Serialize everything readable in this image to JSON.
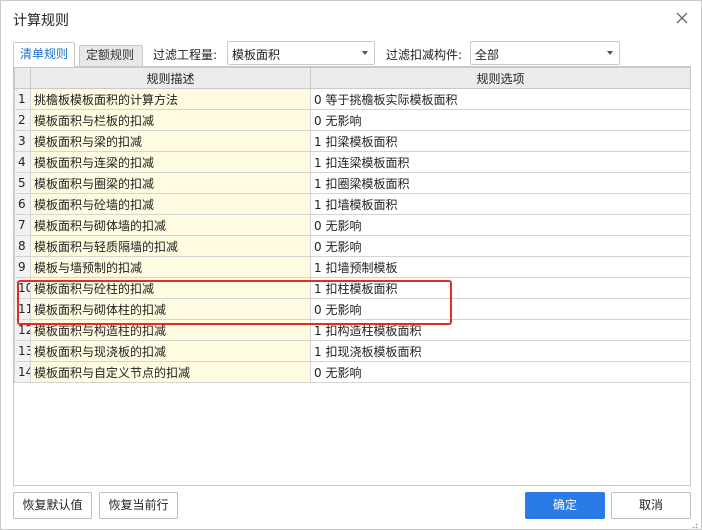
{
  "dialog": {
    "title": "计算规则"
  },
  "tabs": [
    {
      "label": "清单规则",
      "active": true
    },
    {
      "label": "定额规则",
      "active": false
    }
  ],
  "filters": {
    "engineering_label": "过滤工程量:",
    "engineering_value": "模板面积",
    "component_label": "过滤扣减构件:",
    "component_value": "全部"
  },
  "table": {
    "headers": [
      "",
      "规则描述",
      "规则选项"
    ],
    "rows": [
      {
        "num": "1",
        "desc": "挑檐板模板面积的计算方法",
        "opt": "0 等于挑檐板实际模板面积"
      },
      {
        "num": "2",
        "desc": "模板面积与栏板的扣减",
        "opt": "0  无影响"
      },
      {
        "num": "3",
        "desc": "模板面积与梁的扣减",
        "opt": "1 扣梁模板面积"
      },
      {
        "num": "4",
        "desc": "模板面积与连梁的扣减",
        "opt": "1 扣连梁模板面积"
      },
      {
        "num": "5",
        "desc": "模板面积与圈梁的扣减",
        "opt": "1 扣圈梁模板面积"
      },
      {
        "num": "6",
        "desc": "模板面积与砼墙的扣减",
        "opt": "1 扣墙模板面积"
      },
      {
        "num": "7",
        "desc": "模板面积与砌体墙的扣减",
        "opt": "0  无影响"
      },
      {
        "num": "8",
        "desc": "模板面积与轻质隔墙的扣减",
        "opt": "0  无影响"
      },
      {
        "num": "9",
        "desc": "模板与墙预制的扣减",
        "opt": "1  扣墙预制模板"
      },
      {
        "num": "10",
        "desc": "模板面积与砼柱的扣减",
        "opt": "1 扣柱模板面积"
      },
      {
        "num": "11",
        "desc": "模板面积与砌体柱的扣减",
        "opt": "0  无影响"
      },
      {
        "num": "12",
        "desc": "模板面积与构造柱的扣减",
        "opt": "1 扣构造柱模板面积"
      },
      {
        "num": "13",
        "desc": "模板面积与现浇板的扣减",
        "opt": "1 扣现浇板模板面积"
      },
      {
        "num": "14",
        "desc": "模板面积与自定义节点的扣减",
        "opt": "0  无影响"
      }
    ]
  },
  "buttons": {
    "restore_default": "恢复默认值",
    "restore_current": "恢复当前行",
    "ok": "确定",
    "cancel": "取消"
  },
  "colors": {
    "accent": "#2a7be6",
    "highlight": "#e52a2a",
    "desc_bg": "#fefbe1"
  }
}
